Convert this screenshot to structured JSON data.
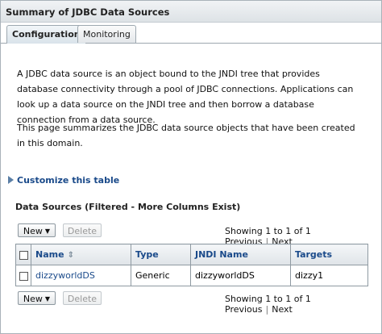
{
  "window": {
    "title": "Summary of JDBC Data Sources"
  },
  "tabs": [
    {
      "label": "Configuration",
      "active": true
    },
    {
      "label": "Monitoring",
      "active": false
    }
  ],
  "description": {
    "para1": "A JDBC data source is an object bound to the JNDI tree that provides database connectivity through a pool of JDBC connections. Applications can look up a data source on the JNDI tree and then borrow a database connection from a data source.",
    "para2": "This page summarizes the JDBC data source objects that have been created in this domain."
  },
  "customize": {
    "label": "Customize this table"
  },
  "table_section": {
    "title": "Data Sources (Filtered - More Columns Exist)",
    "toolbar": {
      "new_label": "New",
      "delete_label": "Delete",
      "showing": "Showing 1 to 1 of 1",
      "previous": "Previous",
      "next": "Next"
    },
    "columns": [
      "Name",
      "Type",
      "JNDI Name",
      "Targets"
    ],
    "rows": [
      {
        "name": "dizzyworldDS",
        "type": "Generic",
        "jndi": "dizzyworldDS",
        "targets": "dizzy1"
      }
    ]
  },
  "colors": {
    "link": "#1a4a8a",
    "header_bg": "#dfe4e8",
    "border": "#8f9aa2"
  }
}
